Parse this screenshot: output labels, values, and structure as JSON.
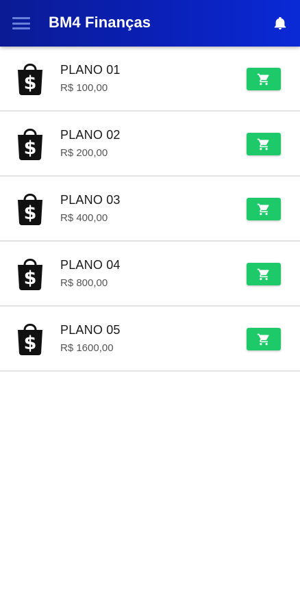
{
  "app_bar": {
    "title": "BM4 Finanças",
    "menu_icon": "menu-icon",
    "notification_icon": "bell-icon"
  },
  "plans": [
    {
      "name": "PLANO 01",
      "price": "R$ 100,00",
      "icon": "money-bag-icon",
      "action_icon": "cart-icon"
    },
    {
      "name": "PLANO 02",
      "price": "R$ 200,00",
      "icon": "money-bag-icon",
      "action_icon": "cart-icon"
    },
    {
      "name": "PLANO 03",
      "price": "R$ 400,00",
      "icon": "money-bag-icon",
      "action_icon": "cart-icon"
    },
    {
      "name": "PLANO 04",
      "price": "R$ 800,00",
      "icon": "money-bag-icon",
      "action_icon": "cart-icon"
    },
    {
      "name": "PLANO 05",
      "price": "R$ 1600,00",
      "icon": "money-bag-icon",
      "action_icon": "cart-icon"
    }
  ],
  "colors": {
    "app_bar_start": "#0b1b94",
    "app_bar_end": "#0a2ad6",
    "buy_button": "#1ec96a",
    "divider": "#e3e3e3"
  }
}
